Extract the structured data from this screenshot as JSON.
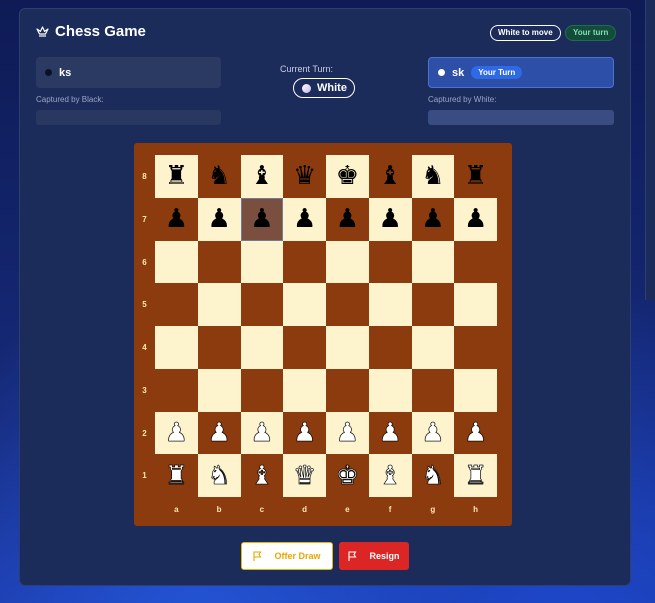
{
  "app": {
    "title": "Chess Game",
    "icon": "crown-icon"
  },
  "status": {
    "move_badge": "White to move",
    "your_turn_badge": "Your turn"
  },
  "players": {
    "black": {
      "name": "ks",
      "captured_label": "Captured by Black:",
      "captured": []
    },
    "white": {
      "name": "sk",
      "chip": "Your Turn",
      "captured_label": "Captured by White:",
      "captured": []
    }
  },
  "turn": {
    "label": "Current Turn:",
    "value": "White"
  },
  "board": {
    "ranks": [
      "8",
      "7",
      "6",
      "5",
      "4",
      "3",
      "2",
      "1"
    ],
    "files": [
      "a",
      "b",
      "c",
      "d",
      "e",
      "f",
      "g",
      "h"
    ],
    "selected": "c7",
    "rows": [
      [
        "br",
        "bn",
        "bb",
        "bq",
        "bk",
        "bb",
        "bn",
        "br"
      ],
      [
        "bp",
        "bp",
        "bp",
        "bp",
        "bp",
        "bp",
        "bp",
        "bp"
      ],
      [
        "",
        "",
        "",
        "",
        "",
        "",
        "",
        ""
      ],
      [
        "",
        "",
        "",
        "",
        "",
        "",
        "",
        ""
      ],
      [
        "",
        "",
        "",
        "",
        "",
        "",
        "",
        ""
      ],
      [
        "",
        "",
        "",
        "",
        "",
        "",
        "",
        ""
      ],
      [
        "wp",
        "wp",
        "wp",
        "wp",
        "wp",
        "wp",
        "wp",
        "wp"
      ],
      [
        "wr",
        "wn",
        "wb",
        "wq",
        "wk",
        "wb",
        "wn",
        "wr"
      ]
    ],
    "colors": {
      "light": "#fdf3cc",
      "dark": "#8b3b0e",
      "selected": "#7a4f3f"
    }
  },
  "actions": {
    "offer_draw": {
      "label": "Offer Draw",
      "icon": "flag-icon",
      "color": "#e6a800"
    },
    "resign": {
      "label": "Resign",
      "icon": "flag-icon",
      "color": "#dc2626"
    }
  }
}
